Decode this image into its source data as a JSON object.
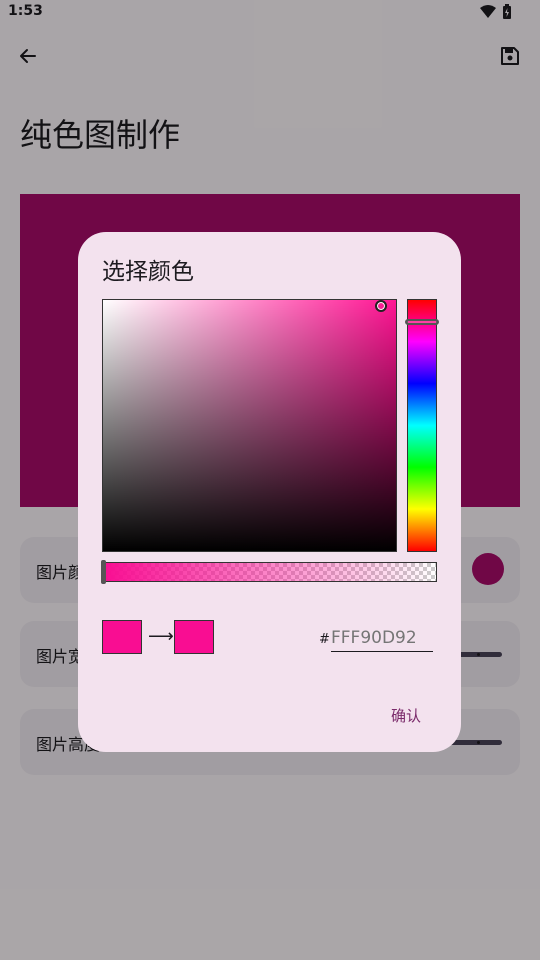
{
  "status_bar": {
    "time": "1:53",
    "icons": [
      "wifi-icon",
      "battery-icon"
    ]
  },
  "top_bar": {
    "back_icon": "arrow-left-icon",
    "save_icon": "save-icon"
  },
  "page": {
    "title": "纯色图制作",
    "preview_color": "#A80B69"
  },
  "settings": {
    "color_label": "图片颜色",
    "color_value": "#A80B69",
    "width_label": "图片宽度",
    "height_label": "图片高度"
  },
  "dialog": {
    "title": "选择颜色",
    "hue_color": "#FF1493",
    "alpha_color": "#F90D92",
    "old_color": "#F90D92",
    "new_color": "#F90D92",
    "hex_prefix": "#",
    "hex_value": "FFF90D92",
    "confirm_label": "确认",
    "arrow": "⟶"
  }
}
